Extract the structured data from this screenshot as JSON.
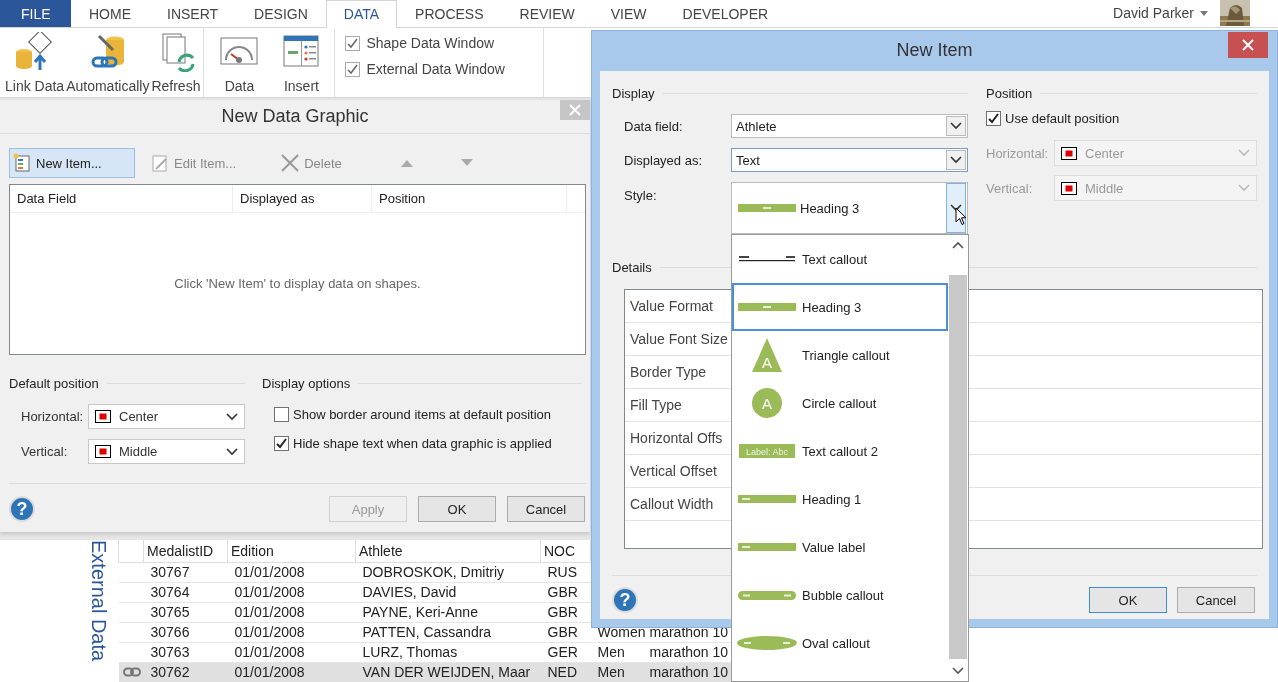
{
  "ribbon_tabs": [
    {
      "label": "FILE",
      "kind": "file",
      "selected": false
    },
    {
      "label": "HOME",
      "kind": "tab",
      "selected": false
    },
    {
      "label": "INSERT",
      "kind": "tab",
      "selected": false
    },
    {
      "label": "DESIGN",
      "kind": "tab",
      "selected": false
    },
    {
      "label": "DATA",
      "kind": "tab",
      "selected": true
    },
    {
      "label": "PROCESS",
      "kind": "tab",
      "selected": false
    },
    {
      "label": "REVIEW",
      "kind": "tab",
      "selected": false
    },
    {
      "label": "VIEW",
      "kind": "tab",
      "selected": false
    },
    {
      "label": "DEVELOPER",
      "kind": "tab",
      "selected": false
    }
  ],
  "user": {
    "name": "David Parker"
  },
  "ribbon_groups": [
    {
      "kind": "commands",
      "commands": [
        "Link Data",
        "Automatically",
        "Refresh"
      ]
    },
    {
      "kind": "commands",
      "commands": [
        "Data",
        "Insert"
      ]
    },
    {
      "kind": "checkboxes",
      "checkboxes": [
        {
          "label": "Shape Data Window",
          "checked": true
        },
        {
          "label": "External Data Window",
          "checked": true
        }
      ]
    }
  ],
  "data_graphic_dialog": {
    "title": "New Data Graphic",
    "toolbar": [
      {
        "label": "New Item...",
        "disabled": false,
        "hovered": true
      },
      {
        "label": "Edit Item...",
        "disabled": true,
        "hovered": false
      },
      {
        "label": "Delete",
        "disabled": true,
        "hovered": false
      }
    ],
    "columns": [
      "Data Field",
      "Displayed as",
      "Position"
    ],
    "empty_message": "Click 'New Item' to display data on shapes.",
    "default_position": {
      "title": "Default position",
      "fields": [
        {
          "label": "Horizontal:",
          "value": "Center"
        },
        {
          "label": "Vertical:",
          "value": "Middle"
        }
      ]
    },
    "display_options": {
      "title": "Display options",
      "options": [
        {
          "label": "Show border around items at default position",
          "checked": false
        },
        {
          "label": "Hide shape text when data graphic is applied",
          "checked": true
        }
      ]
    },
    "help": "?",
    "buttons": [
      {
        "label": "Apply",
        "disabled": true
      },
      {
        "label": "OK",
        "disabled": false
      },
      {
        "label": "Cancel",
        "disabled": false
      }
    ]
  },
  "external_data": {
    "title": "External Data",
    "columns": [
      "MedalistID",
      "Edition",
      "Athlete",
      "NOC"
    ],
    "rows": [
      {
        "selected": false,
        "linked": false,
        "cells": [
          "30767",
          "01/01/2008",
          "DOBROSKOK, Dmitriy",
          "RUS"
        ]
      },
      {
        "selected": false,
        "linked": false,
        "cells": [
          "30764",
          "01/01/2008",
          "DAVIES, David",
          "GBR"
        ]
      },
      {
        "selected": false,
        "linked": false,
        "cells": [
          "30765",
          "01/01/2008",
          "PAYNE, Keri-Anne",
          "GBR"
        ]
      },
      {
        "selected": false,
        "linked": false,
        "cells": [
          "30766",
          "01/01/2008",
          "PATTEN, Cassandra",
          "GBR",
          "Women",
          "marathon 10"
        ]
      },
      {
        "selected": false,
        "linked": false,
        "cells": [
          "30763",
          "01/01/2008",
          "LURZ, Thomas",
          "GER",
          "Men",
          "marathon 10"
        ]
      },
      {
        "selected": true,
        "linked": true,
        "cells": [
          "30762",
          "01/01/2008",
          "VAN DER WEIJDEN, Maar",
          "NED",
          "Men",
          "marathon 10"
        ]
      }
    ]
  },
  "new_item_dialog": {
    "title": "New Item",
    "display": {
      "title": "Display",
      "fields": [
        {
          "label": "Data field:",
          "value": "Athlete",
          "focused": false
        },
        {
          "label": "Displayed as:",
          "value": "Text",
          "focused": true
        }
      ],
      "style": {
        "label": "Style:",
        "value": "Heading 3",
        "kind": "bar",
        "expanded": true
      }
    },
    "position": {
      "title": "Position",
      "use_default": {
        "label": "Use default position",
        "checked": true
      },
      "fields": [
        {
          "label": "Horizontal:",
          "value": "Center",
          "disabled": true
        },
        {
          "label": "Vertical:",
          "value": "Middle",
          "disabled": true
        }
      ]
    },
    "details": {
      "title": "Details",
      "rows": [
        "Value Format",
        "Value Font Size",
        "Border Type",
        "Fill Type",
        "Horizontal Offs",
        "Vertical Offset",
        "Callout Width"
      ]
    },
    "help": "?",
    "buttons": [
      {
        "label": "OK",
        "default": true
      },
      {
        "label": "Cancel",
        "default": false
      }
    ]
  },
  "style_list": [
    {
      "label": "Text callout",
      "kind": "line",
      "selected": false
    },
    {
      "label": "Heading 3",
      "kind": "bar",
      "selected": true
    },
    {
      "label": "Triangle callout",
      "kind": "triangle",
      "selected": false,
      "preview_text": "A"
    },
    {
      "label": "Circle callout",
      "kind": "circle",
      "selected": false,
      "preview_text": "A"
    },
    {
      "label": "Text callout 2",
      "kind": "labelbar",
      "selected": false,
      "preview_text": "Label:  Abc"
    },
    {
      "label": "Heading 1",
      "kind": "bar",
      "selected": false
    },
    {
      "label": "Value label",
      "kind": "bar",
      "selected": false
    },
    {
      "label": "Bubble callout",
      "kind": "bubble",
      "selected": false
    },
    {
      "label": "Oval callout",
      "kind": "oval",
      "selected": false
    }
  ]
}
